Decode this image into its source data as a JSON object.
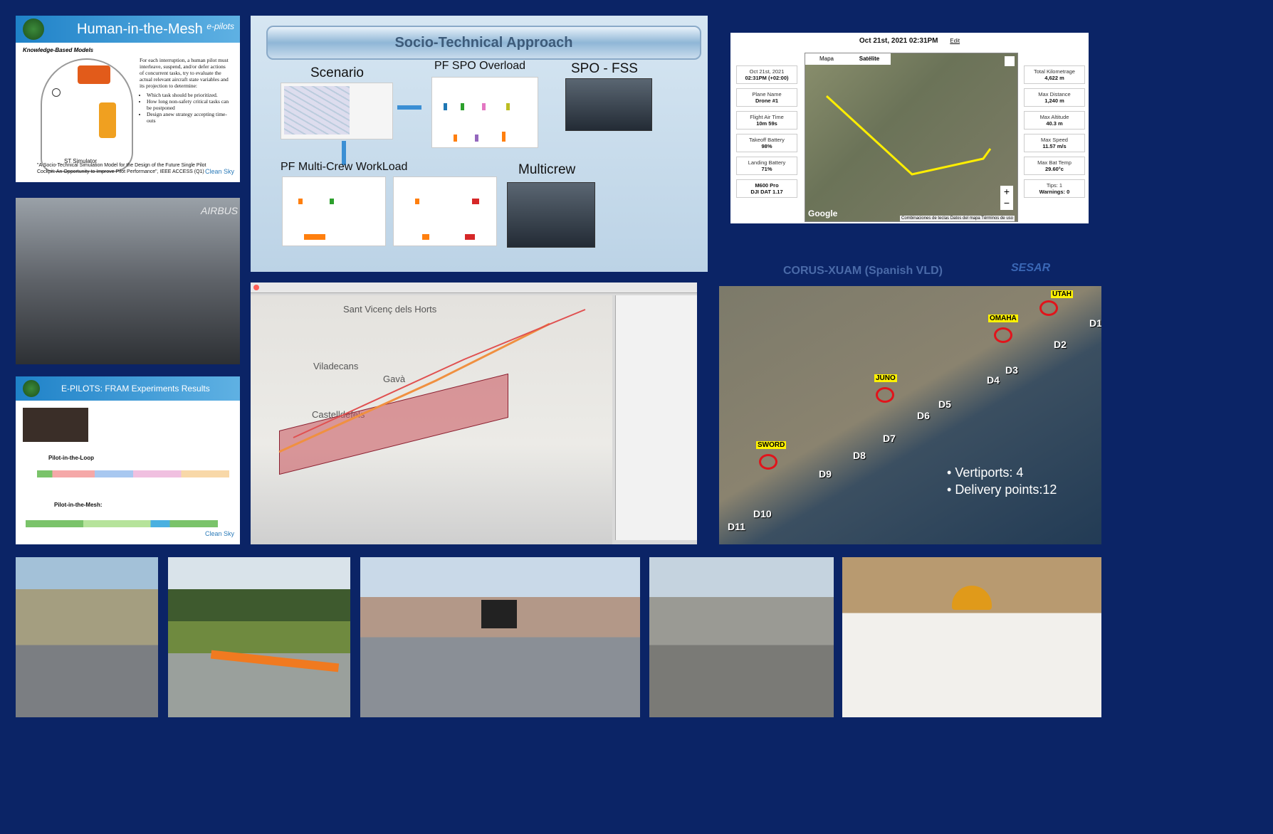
{
  "hitm": {
    "title": "Human-in-the-Mesh",
    "logo": "e-pilots",
    "subtitle": "Knowledge-Based Models",
    "paragraph": "For each interruption, a human pilot must interleave, suspend, and/or defer actions of concurrent tasks, try to evaluate the actual relevant aircraft state variables and its projection to determine:",
    "bullets": [
      "Which task should be prioritized.",
      "How long non-safety critical tasks can be postponed",
      "Design anew strategy accepting time-outs"
    ],
    "diagram_caption": "ST Simulator",
    "citation": "\"A Socio-Technical Simulation Model for the Design of the Future Single Pilot Cockpit: An Opportunity to Improve Pilot Performance\", IEEE ACCESS (Q1)",
    "partner": "Clean Sky"
  },
  "socio": {
    "banner": "Socio-Technical Approach",
    "scenario": "Scenario",
    "spo_overload": "PF SPO Overload",
    "spo_fss": "SPO - FSS",
    "multicrew_workload": "PF Multi-Crew WorkLoad",
    "multicrew": "Multicrew"
  },
  "flightlog": {
    "date_title": "Oct 21st, 2021 02:31PM",
    "edit": "Edit",
    "left": [
      {
        "label": "Oct 21st, 2021",
        "value": "02:31PM (+02:00)"
      },
      {
        "label": "Plane Name",
        "value": "Drone #1"
      },
      {
        "label": "Flight Air Time",
        "value": "10m 59s"
      },
      {
        "label": "Takeoff Battery",
        "value": "98%"
      },
      {
        "label": "Landing Battery",
        "value": "71%"
      },
      {
        "label": "M600 Pro",
        "value": "DJI DAT 1.17"
      }
    ],
    "right": [
      {
        "label": "Total Kilometrage",
        "value": "4,622 m"
      },
      {
        "label": "Max Distance",
        "value": "1,240 m"
      },
      {
        "label": "Max Altitude",
        "value": "40.3 m"
      },
      {
        "label": "Max Speed",
        "value": "11.57 m/s"
      },
      {
        "label": "Max Bat Temp",
        "value": "29.60°c"
      },
      {
        "label": "Tips: 1",
        "value": "Warnings: 0"
      }
    ],
    "map_tabs": [
      "Mapa",
      "Satélite"
    ],
    "map_brand": "Google",
    "map_footer": "Combinaciones de teclas   Datos del mapa   Términos de uso"
  },
  "corus": {
    "title": "CORUS-XUAM (Spanish VLD)",
    "sesar": "SESAR",
    "vertiports": [
      "UTAH",
      "OMAHA",
      "JUNO",
      "SWORD"
    ],
    "delivery": [
      "D1",
      "D2",
      "D3",
      "D4",
      "D5",
      "D6",
      "D7",
      "D8",
      "D9",
      "D10",
      "D11"
    ],
    "legend": [
      "Vertiports: 4",
      "Delivery points:12"
    ]
  },
  "gis": {
    "places": [
      "Sant Vicenç dels Horts",
      "Viladecans",
      "Gavà",
      "Castelldefels"
    ]
  },
  "fram": {
    "title": "E-PILOTS: FRAM Experiments Results",
    "loop": "Pilot-in-the-Loop",
    "mesh": "Pilot-in-the-Mesh:",
    "partner": "Clean Sky"
  },
  "colors": {
    "background": "#0b2466",
    "accent": "#1f82c8",
    "route": "#ffee00",
    "ring": "#e1141b"
  }
}
